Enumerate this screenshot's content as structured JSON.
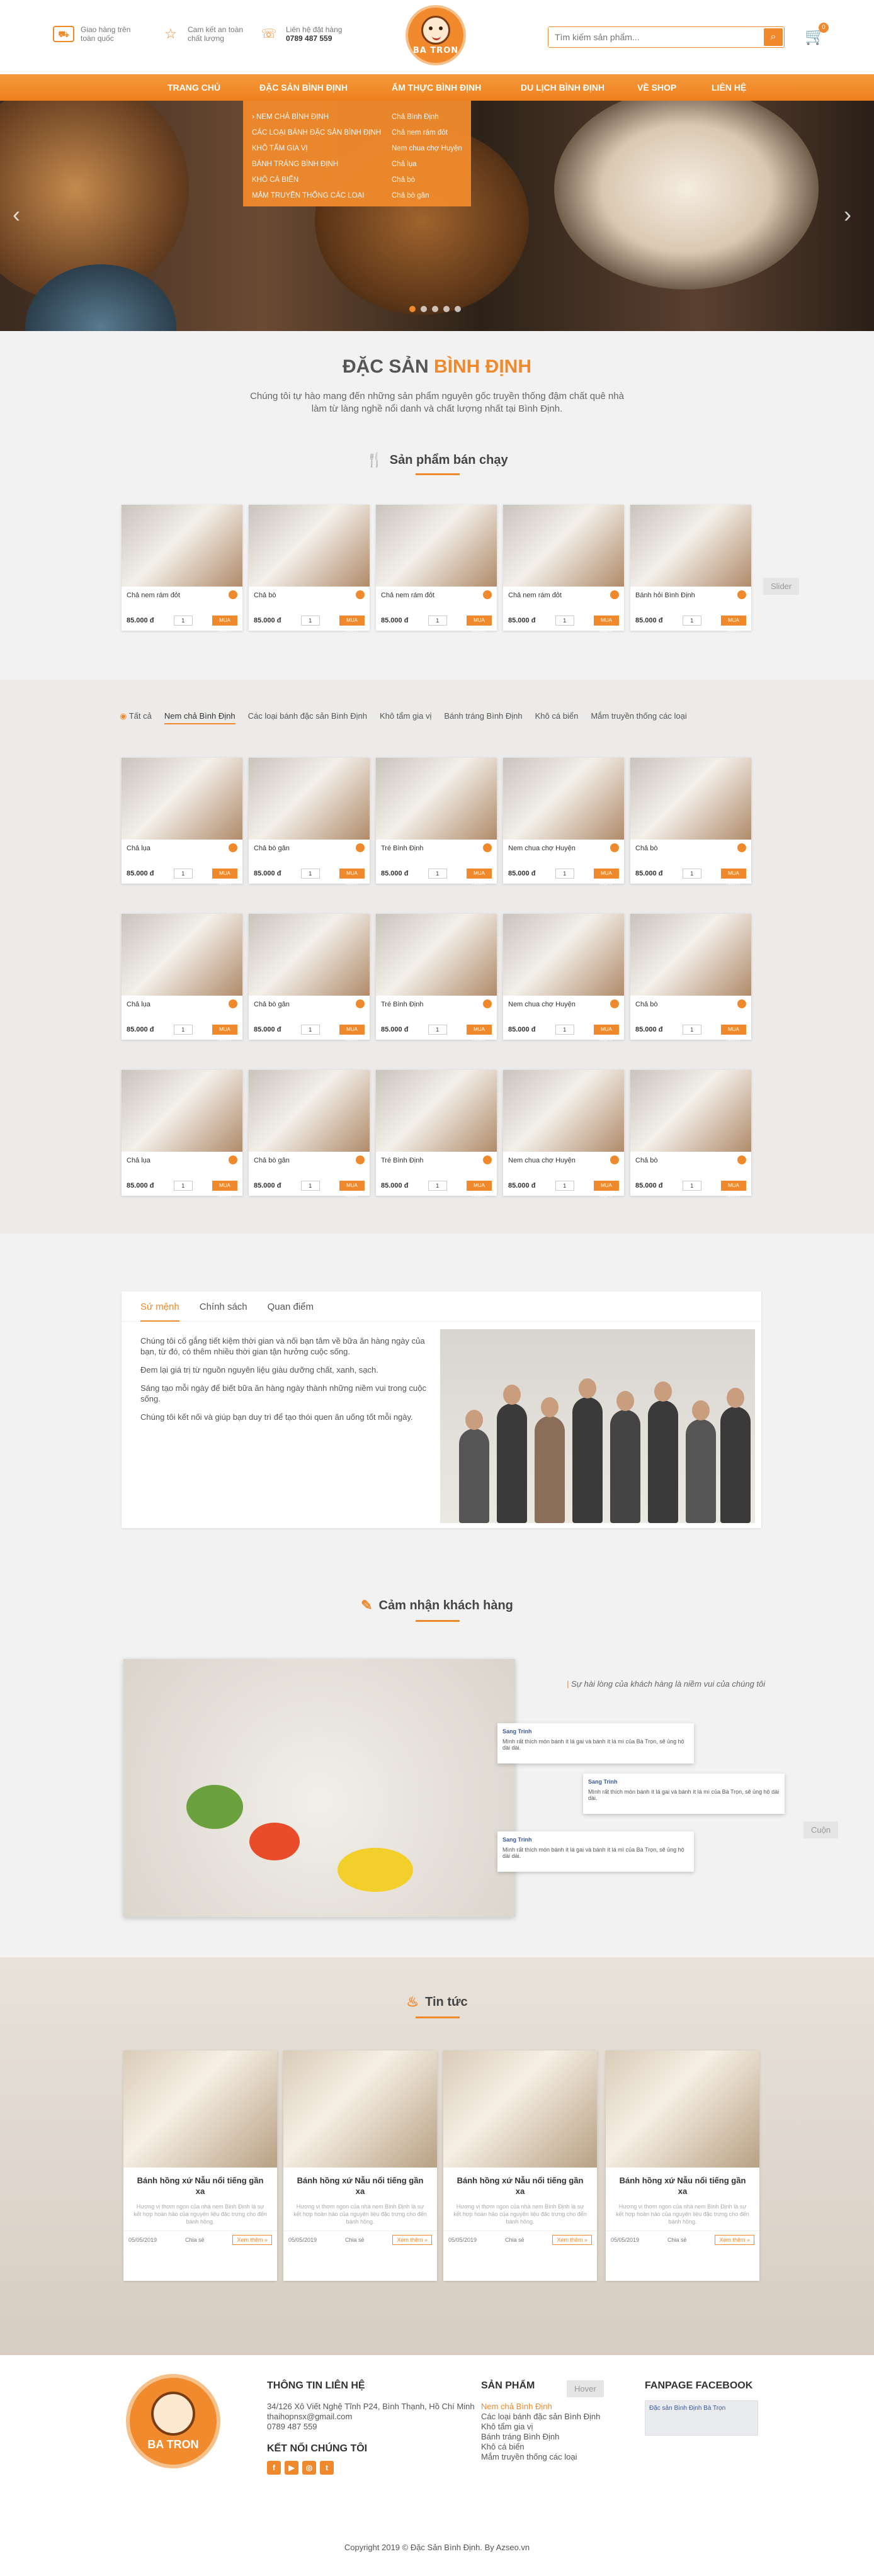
{
  "header": {
    "features": [
      {
        "icon": "truck-icon",
        "line1": "Giao hàng trên",
        "line2": "toàn quốc"
      },
      {
        "icon": "star-icon",
        "line1": "Cam kết an toàn",
        "line2": "chất lượng"
      },
      {
        "icon": "phone-icon",
        "line1": "Liên hệ đặt hàng",
        "line2": "0789 487 559"
      }
    ],
    "logo_text": "BA TRON",
    "search_placeholder": "Tìm kiếm sản phẩm...",
    "cart_count": "0"
  },
  "nav": [
    "TRANG CHỦ",
    "ĐẶC SẢN BÌNH ĐỊNH",
    "ẨM THỰC BÌNH ĐỊNH",
    "DU LỊCH BÌNH ĐỊNH",
    "VỀ SHOP",
    "LIÊN HỆ"
  ],
  "dropdown": {
    "col1": [
      "NEM CHẢ BÌNH ĐỊNH",
      "CÁC LOẠI BÁNH ĐẶC SẢN BÌNH ĐỊNH",
      "KHÔ TẨM GIA VỊ",
      "BÁNH TRÁNG BÌNH ĐỊNH",
      "KHÔ CÁ BIỂN",
      "MẮM TRUYỀN THỐNG CÁC LOẠI"
    ],
    "col2": [
      "Chả Bình Định",
      "Chả nem rám đỏt",
      "Nem chua chợ Huyện",
      "Chả lụa",
      "Chả bò",
      "Chả bò gân"
    ]
  },
  "intro": {
    "title_a": "ĐẶC SẢN",
    "title_b": "BÌNH ĐỊNH",
    "desc1": "Chúng tôi tự hào mang đến những sản phẩm nguyên gốc truyền thống đậm chất quê nhà",
    "desc2": "làm từ làng nghề nổi danh và chất lượng nhất tại Bình Định."
  },
  "bestseller": {
    "heading": "Sản phẩm bán chạy",
    "slider_tag": "Slider",
    "items": [
      {
        "name": "Chả nem rám đỏt",
        "price": "85.000 đ"
      },
      {
        "name": "Chả bò",
        "price": "85.000 đ"
      },
      {
        "name": "Chả nem rám đỏt",
        "price": "85.000 đ"
      },
      {
        "name": "Chả nem rám đỏt",
        "price": "85.000 đ"
      },
      {
        "name": "Bánh hỏi Bình Định",
        "price": "85.000 đ"
      }
    ]
  },
  "catalog": {
    "tabs": [
      "Tất cả",
      "Nem chả Bình Định",
      "Các loại bánh đặc sản Bình Định",
      "Khô tẩm gia vị",
      "Bánh tráng Bình Định",
      "Khô cá biển",
      "Mắm truyền thống các loại"
    ],
    "rows": [
      [
        {
          "name": "Chả lụa",
          "price": "85.000 đ"
        },
        {
          "name": "Chả bò gân",
          "price": "85.000 đ"
        },
        {
          "name": "Tré Bình Định",
          "price": "85.000 đ"
        },
        {
          "name": "Nem chua chợ Huyện",
          "price": "85.000 đ"
        },
        {
          "name": "Chả bò",
          "price": "85.000 đ"
        }
      ],
      [
        {
          "name": "Chả lụa",
          "price": "85.000 đ"
        },
        {
          "name": "Chả bò gân",
          "price": "85.000 đ"
        },
        {
          "name": "Tré Bình Định",
          "price": "85.000 đ"
        },
        {
          "name": "Nem chua chợ Huyện",
          "price": "85.000 đ"
        },
        {
          "name": "Chả bò",
          "price": "85.000 đ"
        }
      ],
      [
        {
          "name": "Chả lụa",
          "price": "85.000 đ"
        },
        {
          "name": "Chả bò gân",
          "price": "85.000 đ"
        },
        {
          "name": "Tré Bình Định",
          "price": "85.000 đ"
        },
        {
          "name": "Nem chua chợ Huyện",
          "price": "85.000 đ"
        },
        {
          "name": "Chả bò",
          "price": "85.000 đ"
        }
      ]
    ],
    "qty": "1",
    "buy_label": "MUA NGAY"
  },
  "mission": {
    "tabs": [
      "Sứ mệnh",
      "Chính sách",
      "Quan điểm"
    ],
    "paragraphs": [
      "Chúng tôi cố gắng tiết kiệm thời gian và nối bạn tâm về bữa ăn hàng ngày của bạn, từ đó, có thêm nhiều thời gian tận hưởng cuộc sống.",
      "Đem lại giá trị từ nguồn nguyên liệu giàu dưỡng chất, xanh, sạch.",
      "Sáng tạo mỗi ngày để biết bữa ăn hàng ngày thành những niềm vui trong cuộc sống.",
      "Chúng tôi kết nối và giúp bạn duy trì để tạo thói quen ăn uống tốt mỗi ngày."
    ]
  },
  "testimonials": {
    "heading": "Cảm nhận khách hàng",
    "quote": "Sự hài lòng của khách hàng là niềm vui của chúng tôi",
    "scroll_tag": "Cuộn",
    "reviews": [
      {
        "author": "Sang Trinh",
        "text": "Mình rất thích món bánh ít lá gai và bánh ít lá mì của Bà Trọn, sẽ ủng hộ dài dài."
      },
      {
        "author": "Sang Trinh",
        "text": "Mình rất thích món bánh ít lá gai và bánh ít lá mì của Bà Trọn, sẽ ủng hộ dài dài."
      },
      {
        "author": "Sang Trinh",
        "text": "Mình rất thích món bánh ít lá gai và bánh ít lá mì của Bà Trọn, sẽ ủng hộ dài dài."
      }
    ]
  },
  "news": {
    "heading": "Tin tức",
    "items": [
      {
        "title": "Bánh hồng xứ Nẫu nổi tiếng gần xa",
        "desc": "Hương vị thơm ngon của nhà nem Bình Định là sự kết hợp hoàn hảo của nguyên liệu đặc trưng cho đến bánh hồng.",
        "date": "05/05/2019",
        "share": "Chia sẻ",
        "more": "Xem thêm »"
      },
      {
        "title": "Bánh hồng xứ Nẫu nổi tiếng gần xa",
        "desc": "Hương vị thơm ngon của nhà nem Bình Định là sự kết hợp hoàn hảo của nguyên liệu đặc trưng cho đến bánh hồng.",
        "date": "05/05/2019",
        "share": "Chia sẻ",
        "more": "Xem thêm »"
      },
      {
        "title": "Bánh hồng xứ Nẫu nổi tiếng gần xa",
        "desc": "Hương vị thơm ngon của nhà nem Bình Định là sự kết hợp hoàn hảo của nguyên liệu đặc trưng cho đến bánh hồng.",
        "date": "05/05/2019",
        "share": "Chia sẻ",
        "more": "Xem thêm »"
      },
      {
        "title": "Bánh hồng xứ Nẫu nổi tiếng gần xa",
        "desc": "Hương vị thơm ngon của nhà nem Bình Định là sự kết hợp hoàn hảo của nguyên liệu đặc trưng cho đến bánh hồng.",
        "date": "05/05/2019",
        "share": "Chia sẻ",
        "more": "Xem thêm »"
      }
    ]
  },
  "footer": {
    "contact_title": "THÔNG TIN LIÊN HỆ",
    "address": "34/126 Xô Viết Nghệ Tĩnh P24, Bình Thạnh, Hồ Chí Minh",
    "email": "thaihopnsx@gmail.com",
    "phone": "0789 487 559",
    "connect_title": "KẾT NỐI CHÚNG TÔI",
    "products_title": "SẢN PHẨM",
    "hover_tag": "Hover",
    "products": [
      "Nem chả Bình Định",
      "Các loại bánh đặc sản Bình Định",
      "Khô tẩm gia vị",
      "Bánh tráng Bình Định",
      "Khô cá biển",
      "Mắm truyền thống các loại"
    ],
    "fanpage_title": "FANPAGE FACEBOOK",
    "fanpage_name": "Đặc sản Bình Định Bà Trọn",
    "copyright": "Copyright 2019 © Đặc Sản Bình Định. By Azseo.vn"
  },
  "colors": {
    "accent": "#f0892b",
    "nav": "#ee7f1c"
  }
}
